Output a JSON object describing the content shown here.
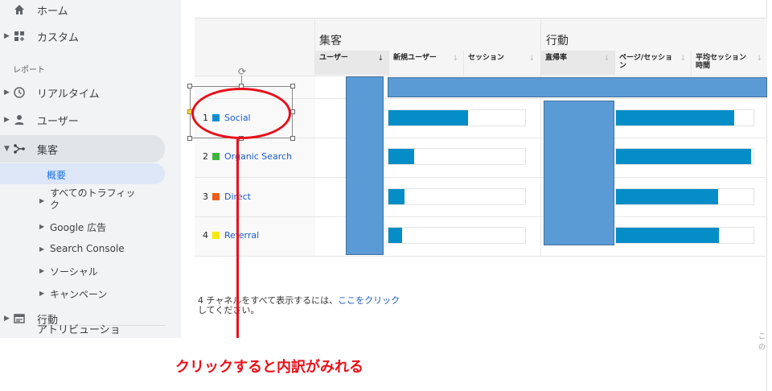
{
  "sidebar": {
    "home": "ホーム",
    "custom": "カスタム",
    "reports_section": "レポート",
    "realtime": "リアルタイム",
    "users": "ユーザー",
    "acquisition": "集客",
    "acquisition_sub": [
      {
        "label": "概要"
      },
      {
        "label": "すべてのトラフィック"
      },
      {
        "label": "Google 広告"
      },
      {
        "label": "Search Console"
      },
      {
        "label": "ソーシャル"
      },
      {
        "label": "キャンペーン"
      }
    ],
    "behavior": "行動",
    "attribution": "アトリビューショ"
  },
  "table": {
    "group_acquisition": "集客",
    "group_behavior": "行動",
    "columns": [
      "ユーザー",
      "新規ユーザー",
      "セッション",
      "直帰率",
      "ページ/セッション",
      "平均セッション時間"
    ],
    "rows": [
      {
        "num": "1",
        "name": "Social",
        "color": "#0b8fd1",
        "new_users_share": 0.58,
        "pages_share": 0.86
      },
      {
        "num": "2",
        "name": "Organic Search",
        "color": "#3fb53f",
        "new_users_share": 0.19,
        "pages_share": 0.98
      },
      {
        "num": "3",
        "name": "Direct",
        "color": "#f05d1e",
        "new_users_share": 0.12,
        "pages_share": 0.74
      },
      {
        "num": "4",
        "name": "Referral",
        "color": "#f5e90a",
        "new_users_share": 0.1,
        "pages_share": 0.75
      }
    ]
  },
  "footer": {
    "text_pre": "4 チャネルをすべて表示するには、",
    "link": "ここをクリック",
    "text_post": "してください。"
  },
  "annotation": {
    "callout": "クリックすると内訳がみれる"
  },
  "edge_fragment": "この"
}
